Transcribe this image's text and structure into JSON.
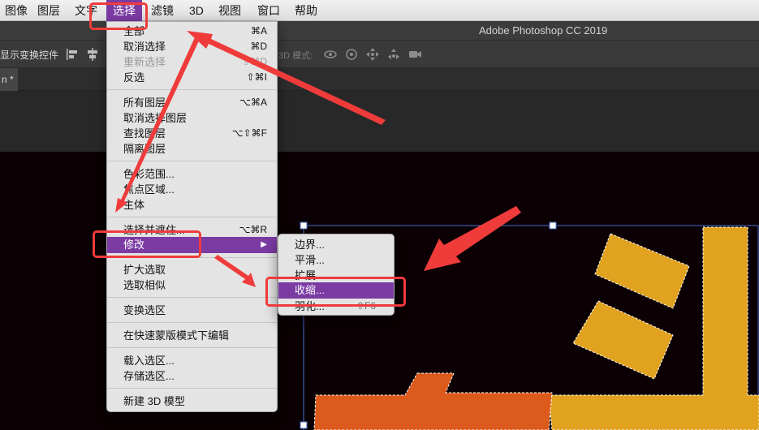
{
  "menubar": {
    "items": [
      {
        "label": "图像"
      },
      {
        "label": "图层"
      },
      {
        "label": "文字"
      },
      {
        "label": "选择"
      },
      {
        "label": "滤镜"
      },
      {
        "label": "3D"
      },
      {
        "label": "视图"
      },
      {
        "label": "窗口"
      },
      {
        "label": "帮助"
      }
    ],
    "active_color": "#7b3ba3"
  },
  "titlebar": {
    "app_title": "Adobe Photoshop CC 2019"
  },
  "options_bar": {
    "show_transform_label": "显示变换控件",
    "mode_3d_label": "3D 模式:",
    "icons": [
      "align-left-icon",
      "align-center-icon",
      "rotate-3d-icon",
      "roll-3d-icon",
      "drag-3d-icon",
      "slide-3d-icon",
      "camera-3d-icon"
    ]
  },
  "tabs": {
    "document_tab": "n *"
  },
  "select_menu": {
    "items": [
      {
        "label": "全部",
        "shortcut": "⌘A"
      },
      {
        "label": "取消选择",
        "shortcut": "⌘D"
      },
      {
        "label": "重新选择",
        "shortcut": "⇧⌘D",
        "disabled": true
      },
      {
        "label": "反选",
        "shortcut": "⇧⌘I"
      },
      {
        "label": "所有图层",
        "shortcut": "⌥⌘A"
      },
      {
        "label": "取消选择图层",
        "shortcut": ""
      },
      {
        "label": "查找图层",
        "shortcut": "⌥⇧⌘F"
      },
      {
        "label": "隔离图层",
        "shortcut": ""
      },
      {
        "label": "色彩范围...",
        "shortcut": ""
      },
      {
        "label": "焦点区域...",
        "shortcut": ""
      },
      {
        "label": "主体",
        "shortcut": ""
      },
      {
        "label": "选择并遮住...",
        "shortcut": "⌥⌘R"
      },
      {
        "label": "修改",
        "shortcut": "",
        "submenu": true,
        "highlighted": true
      },
      {
        "label": "扩大选取",
        "shortcut": ""
      },
      {
        "label": "选取相似",
        "shortcut": ""
      },
      {
        "label": "变换选区",
        "shortcut": ""
      },
      {
        "label": "在快速蒙版模式下编辑",
        "shortcut": ""
      },
      {
        "label": "载入选区...",
        "shortcut": ""
      },
      {
        "label": "存储选区...",
        "shortcut": ""
      },
      {
        "label": "新建 3D 模型",
        "shortcut": ""
      }
    ],
    "submenu_arrow": "▶"
  },
  "modify_submenu": {
    "items": [
      {
        "label": "边界..."
      },
      {
        "label": "平滑..."
      },
      {
        "label": "扩展..."
      },
      {
        "label": "收缩...",
        "highlighted": true
      },
      {
        "label": "羽化...",
        "shortcut": "⇧F6"
      }
    ]
  },
  "colors": {
    "highlight": "#7b3ba3",
    "annotation": "#f03b3b",
    "canvas_bg": "#0b0003",
    "shape_yellow": "#e0a21f",
    "shape_orange": "#dc5a1c"
  }
}
